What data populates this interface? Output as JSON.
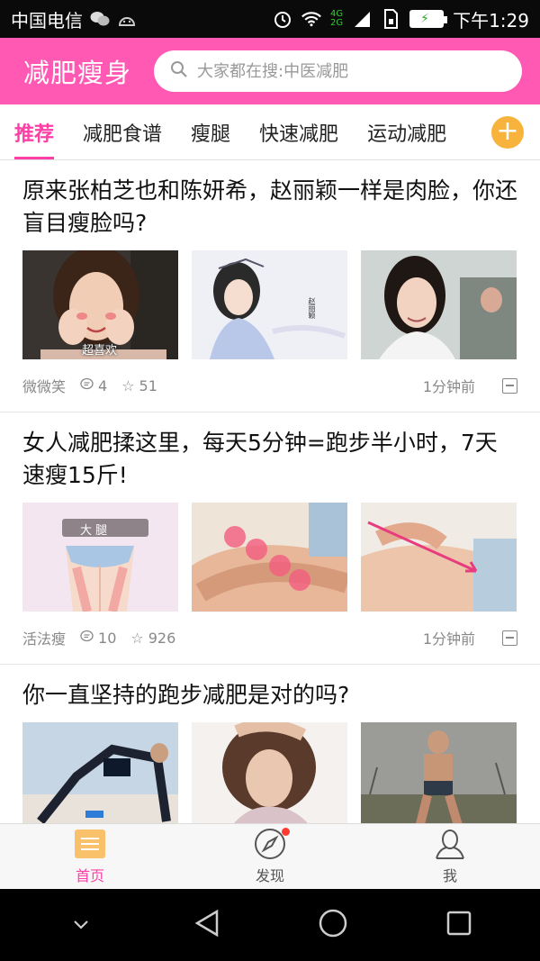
{
  "status_bar": {
    "carrier": "中国电信",
    "net_4g": "4G",
    "net_2g": "2G",
    "time": "下午1:29"
  },
  "header": {
    "title": "减肥瘦身",
    "search_placeholder": "大家都在搜:中医减肥"
  },
  "tabs": [
    {
      "label": "推荐",
      "active": true
    },
    {
      "label": "减肥食谱",
      "active": false
    },
    {
      "label": "瘦腿",
      "active": false
    },
    {
      "label": "快速减肥",
      "active": false
    },
    {
      "label": "运动减肥",
      "active": false
    }
  ],
  "feed": [
    {
      "title": "原来张柏芝也和陈妍希，赵丽颖一样是肉脸，你还盲目瘦脸吗?",
      "image_captions": [
        "超喜欢",
        "赵丽颖"
      ],
      "source": "微微笑",
      "comments": "4",
      "favorites": "51",
      "time": "1分钟前"
    },
    {
      "title": "女人减肥揉这里，每天5分钟=跑步半小时，7天速瘦15斤!",
      "image_captions": [
        "大 腿"
      ],
      "source": "活法瘦",
      "comments": "10",
      "favorites": "926",
      "time": "1分钟前"
    },
    {
      "title": "你一直坚持的跑步减肥是对的吗?"
    }
  ],
  "bottom_nav": [
    {
      "label": "首页",
      "icon": "home-list-icon",
      "active": true
    },
    {
      "label": "发现",
      "icon": "compass-icon",
      "active": false,
      "badge": true
    },
    {
      "label": "我",
      "icon": "person-icon",
      "active": false
    }
  ],
  "colors": {
    "brand_pink": "#ff59b4",
    "active_tab": "#ff3fa5",
    "plus_button": "#f8b33c"
  }
}
